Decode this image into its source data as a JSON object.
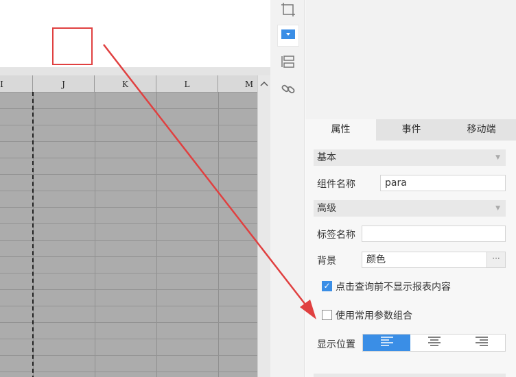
{
  "grid": {
    "columns": [
      "I",
      "J",
      "K",
      "L",
      "M"
    ]
  },
  "panel": {
    "tabs": [
      "属性",
      "事件",
      "移动端"
    ],
    "sections": {
      "basic": "基本",
      "advanced": "高级"
    },
    "fields": {
      "component_name_label": "组件名称",
      "component_name_value": "para",
      "tag_name_label": "标签名称",
      "tag_name_value": "",
      "background_label": "背景",
      "background_value": "颜色",
      "more_label": "···",
      "hide_report_label": "点击查询前不显示报表内容",
      "hide_report_checked": true,
      "common_params_label": "使用常用参数组合",
      "common_params_checked": false,
      "display_position_label": "显示位置"
    }
  },
  "colors": {
    "accent": "#3a8ee6",
    "annotation": "#e04040",
    "grid_cell": "#acacac"
  },
  "icons": [
    "frame-icon",
    "dropdown-widget-icon",
    "layout-icon",
    "link-icon",
    "align-left-icon",
    "align-center-icon",
    "align-right-icon",
    "scroll-up-icon",
    "chevron-down-icon"
  ]
}
